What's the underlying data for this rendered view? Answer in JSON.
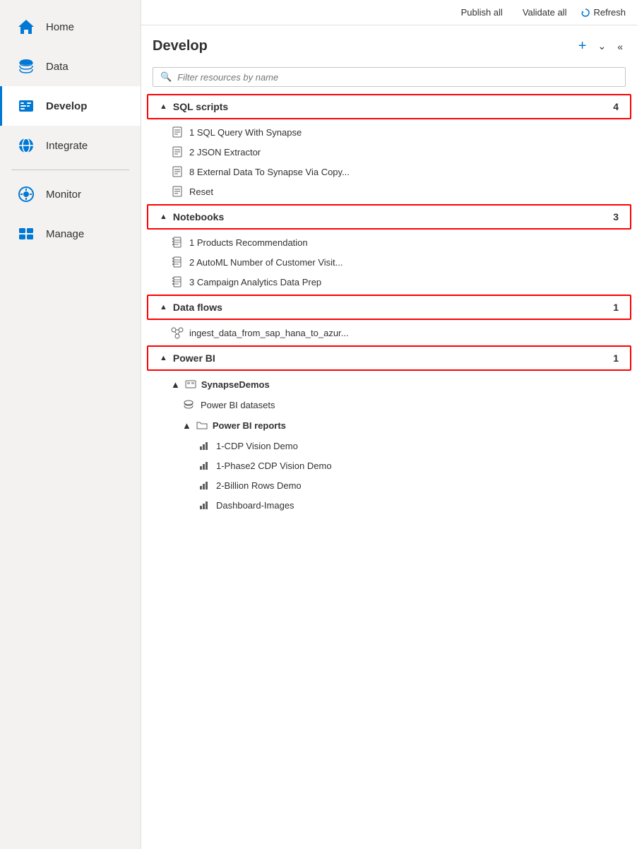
{
  "sidebar": {
    "items": [
      {
        "id": "home",
        "label": "Home",
        "icon": "home",
        "active": false
      },
      {
        "id": "data",
        "label": "Data",
        "icon": "data",
        "active": false
      },
      {
        "id": "develop",
        "label": "Develop",
        "icon": "develop",
        "active": true
      },
      {
        "id": "integrate",
        "label": "Integrate",
        "icon": "integrate",
        "active": false
      },
      {
        "id": "monitor",
        "label": "Monitor",
        "icon": "monitor",
        "active": false
      },
      {
        "id": "manage",
        "label": "Manage",
        "icon": "manage",
        "active": false
      }
    ]
  },
  "topbar": {
    "publish_all": "Publish all",
    "validate_all": "Validate all",
    "refresh": "Refresh"
  },
  "develop": {
    "title": "Develop",
    "add_label": "+",
    "chevron_label": "⌄",
    "collapse_label": "«",
    "filter_placeholder": "Filter resources by name",
    "sections": [
      {
        "id": "sql-scripts",
        "label": "SQL scripts",
        "count": "4",
        "highlighted": true,
        "items": [
          {
            "label": "1 SQL Query With Synapse"
          },
          {
            "label": "2 JSON Extractor"
          },
          {
            "label": "8 External Data To Synapse Via Copy..."
          },
          {
            "label": "Reset"
          }
        ]
      },
      {
        "id": "notebooks",
        "label": "Notebooks",
        "count": "3",
        "highlighted": true,
        "items": [
          {
            "label": "1 Products Recommendation"
          },
          {
            "label": "2 AutoML Number of Customer Visit..."
          },
          {
            "label": "3 Campaign Analytics Data Prep"
          }
        ]
      },
      {
        "id": "data-flows",
        "label": "Data flows",
        "count": "1",
        "highlighted": true,
        "items": [
          {
            "label": "ingest_data_from_sap_hana_to_azur..."
          }
        ]
      },
      {
        "id": "power-bi",
        "label": "Power BI",
        "count": "1",
        "highlighted": true,
        "sub_sections": [
          {
            "label": "SynapseDemos",
            "children": [
              {
                "type": "leaf",
                "label": "Power BI datasets",
                "indent": "deep"
              },
              {
                "type": "folder",
                "label": "Power BI reports",
                "items": [
                  "1-CDP Vision Demo",
                  "1-Phase2 CDP Vision Demo",
                  "2-Billion Rows Demo",
                  "Dashboard-Images"
                ]
              }
            ]
          }
        ]
      }
    ]
  }
}
